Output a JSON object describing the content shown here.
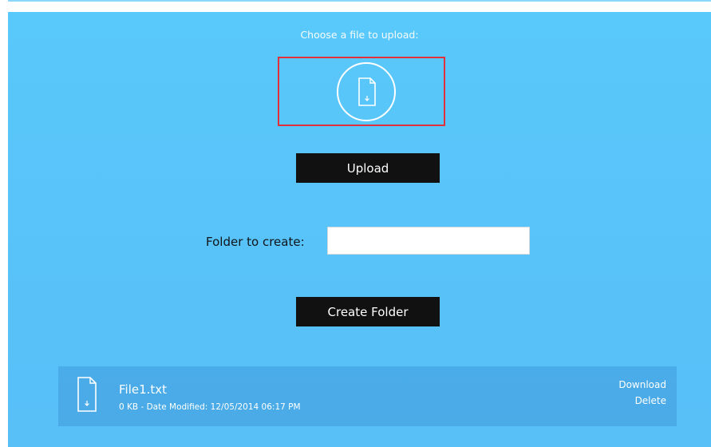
{
  "upload": {
    "prompt": "Choose a file to upload:",
    "dropzone_icon": "file-download-icon",
    "button_label": "Upload"
  },
  "folder": {
    "label": "Folder to create:",
    "input_value": "",
    "input_placeholder": "",
    "create_button_label": "Create Folder"
  },
  "files": [
    {
      "icon": "file-icon",
      "name": "File1.txt",
      "meta": "0 KB - Date Modified: 12/05/2014 06:17 PM",
      "download_label": "Download",
      "delete_label": "Delete"
    }
  ],
  "colors": {
    "background": "#59c8fb",
    "button": "#111111",
    "highlight": "#e0303a"
  }
}
